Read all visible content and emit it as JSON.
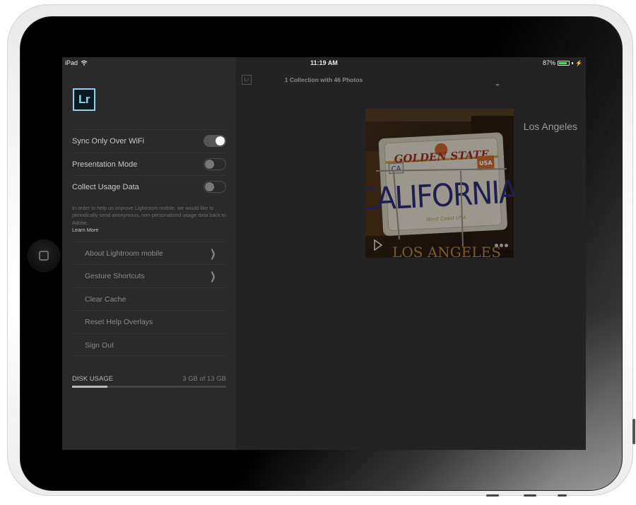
{
  "status_bar": {
    "device": "iPad",
    "time": "11:19 AM",
    "battery_percent": "87%",
    "battery_level": 0.87,
    "icons": [
      "wifi-icon",
      "battery-icon",
      "charging-bolt-icon"
    ]
  },
  "sidebar": {
    "logo": "Lr",
    "settings": [
      {
        "label": "Sync Only Over WiFi",
        "on": true
      },
      {
        "label": "Presentation Mode",
        "on": false
      },
      {
        "label": "Collect Usage Data",
        "on": false
      }
    ],
    "usage_description": "In order to help us improve Lightroom mobile, we would like to periodically send anonymous, non-personalized usage data back to Adobe.",
    "learn_more": "Learn More",
    "menu": [
      {
        "label": "About Lightroom mobile",
        "chevron": true
      },
      {
        "label": "Gesture Shortcuts",
        "chevron": true
      },
      {
        "label": "Clear Cache",
        "chevron": false
      },
      {
        "label": "Reset Help Overlays",
        "chevron": false
      },
      {
        "label": "Sign Out",
        "chevron": false
      }
    ],
    "disk_usage": {
      "label": "DISK USAGE",
      "value": "3 GB of 13 GB",
      "used_fraction": 0.23
    }
  },
  "main": {
    "logo": "Lr",
    "collection_summary": "1 Collection with 46 Photos",
    "collections": [
      {
        "name": "Los Angeles",
        "thumbnail": "California license plate photo"
      }
    ]
  },
  "colors": {
    "lr_accent": "#8fd4e3",
    "battery_green": "#4cd964",
    "sidebar_bg": "#2a2a2a",
    "main_bg": "#232323"
  }
}
